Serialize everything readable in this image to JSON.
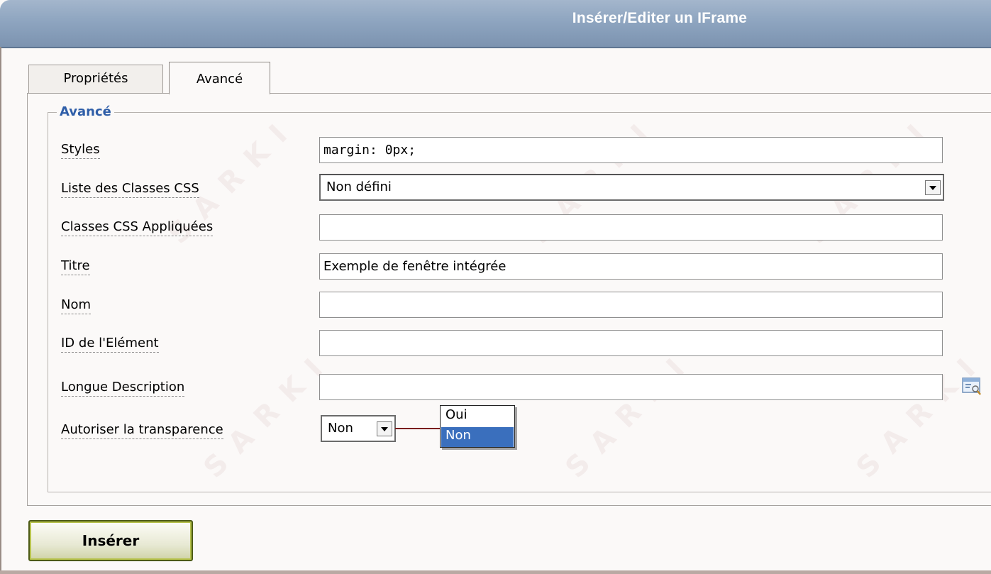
{
  "window": {
    "title": "Insérer/Editer un IFrame"
  },
  "tabs": [
    {
      "label": "Propriétés",
      "active": false
    },
    {
      "label": "Avancé",
      "active": true
    }
  ],
  "fieldset": {
    "legend": "Avancé"
  },
  "fields": {
    "styles": {
      "label": "Styles",
      "value": "margin: 0px;"
    },
    "classes_list": {
      "label": "Liste des Classes CSS",
      "value": "Non défini"
    },
    "applied_classes": {
      "label": "Classes CSS Appliquées",
      "value": ""
    },
    "title": {
      "label": "Titre",
      "value": "Exemple de fenêtre intégrée"
    },
    "name": {
      "label": "Nom",
      "value": ""
    },
    "element_id": {
      "label": "ID de l'Elément",
      "value": ""
    },
    "long_description": {
      "label": "Longue Description",
      "value": ""
    },
    "transparency": {
      "label": "Autoriser la transparence",
      "value": "Non",
      "options": [
        "Oui",
        "Non"
      ],
      "highlighted": "Non"
    }
  },
  "buttons": {
    "insert": "Insérer"
  },
  "watermark": {
    "text": "SARKI"
  },
  "colors": {
    "titlebar": "#8ea5c0",
    "legend": "#2f5ea8",
    "selection": "#3a6fbd",
    "button_border": "#4c5a16"
  }
}
